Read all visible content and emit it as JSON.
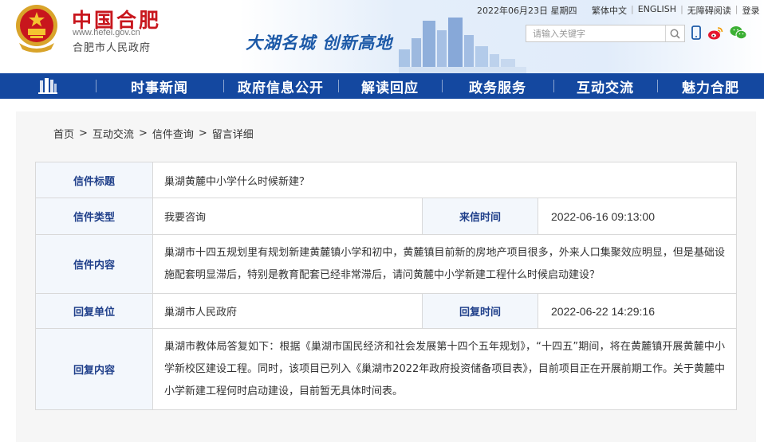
{
  "header": {
    "site_name": "中国合肥",
    "site_url": "www.hefei.gov.cn",
    "site_sub": "合肥市人民政府",
    "slogan": "大湖名城  创新高地",
    "date": "2022年06月23日 星期四",
    "links": [
      "繁体中文",
      "ENGLISH",
      "无障碍阅读",
      "登录"
    ],
    "search_placeholder": "请输入关键字",
    "search_icon": "search-icon",
    "social_icons": [
      "mobile-icon",
      "weibo-icon",
      "wechat-icon"
    ]
  },
  "nav": {
    "home_icon": "building-icon",
    "items": [
      "时事新闻",
      "政府信息公开",
      "解读回应",
      "政务服务",
      "互动交流",
      "魅力合肥"
    ]
  },
  "breadcrumb": [
    "首页",
    "互动交流",
    "信件查询",
    "留言详细"
  ],
  "letter": {
    "title_label": "信件标题",
    "title": "巢湖黄麓中小学什么时候新建？",
    "type_label": "信件类型",
    "type": "我要咨询",
    "time_label": "来信时间",
    "time": "2022-06-16 09:13:00",
    "content_label": "信件内容",
    "content": "巢湖市十四五规划里有规划新建黄麓镇小学和初中，黄麓镇目前新的房地产项目很多，外来人口集聚效应明显，但是基础设施配套明显滞后，特别是教育配套已经非常滞后，请问黄麓中小学新建工程什么时候启动建设？",
    "reply_unit_label": "回复单位",
    "reply_unit": "巢湖市人民政府",
    "reply_time_label": "回复时间",
    "reply_time": "2022-06-22 14:29:16",
    "reply_content_label": "回复内容",
    "reply_content": "巢湖市教体局答复如下：根据《巢湖市国民经济和社会发展第十四个五年规划》，“十四五”期间，将在黄麓镇开展黄麓中小学新校区建设工程。同时，该项目已列入《巢湖市2022年政府投资储备项目表》，目前项目正在开展前期工作。关于黄麓中小学新建工程何时启动建设，目前暂无具体时间表。"
  },
  "colors": {
    "nav_bg": "#1448a0",
    "brand_red": "#c8161d",
    "label_blue": "#1f3f8a",
    "slogan_blue": "#1d5aa8"
  }
}
